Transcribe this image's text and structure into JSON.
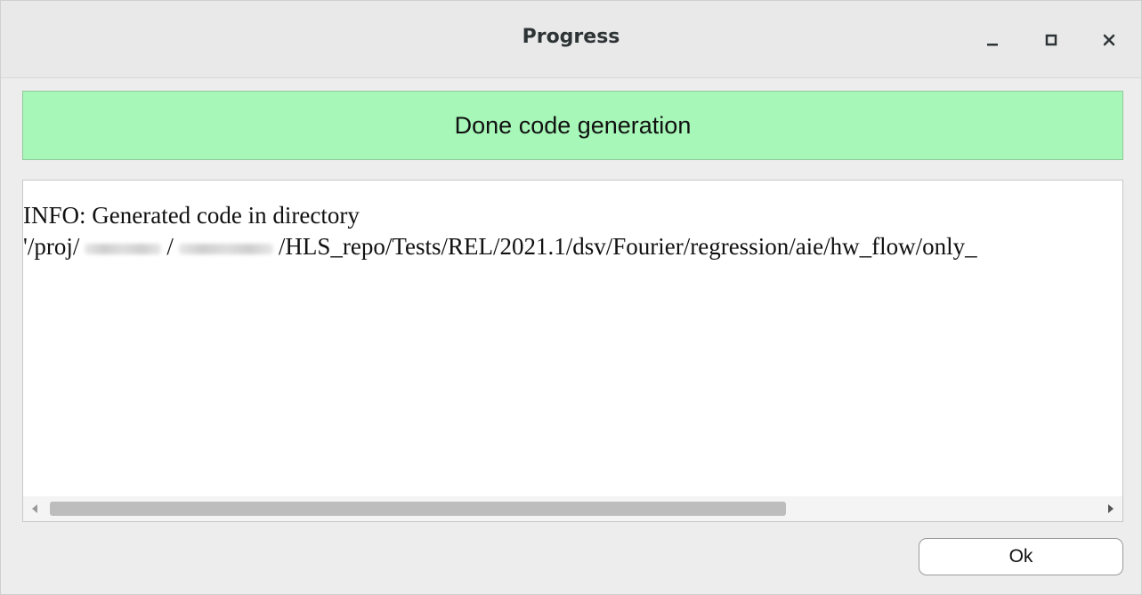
{
  "window": {
    "title": "Progress",
    "controls": {
      "minimize_icon": "minimize-icon",
      "maximize_icon": "maximize-icon",
      "close_icon": "close-icon"
    }
  },
  "status": {
    "text": "Done code generation",
    "color": "#a6f7b8"
  },
  "log": {
    "line1": "INFO: Generated code in directory",
    "line2_prefix": "'/proj/",
    "line2_sep": "/",
    "line2_suffix": "/HLS_repo/Tests/REL/2021.1/dsv/Fourier/regression/aie/hw_flow/only_"
  },
  "scrollbar": {
    "left_icon": "scroll-left-icon",
    "right_icon": "scroll-right-icon"
  },
  "footer": {
    "ok_label": "Ok"
  }
}
